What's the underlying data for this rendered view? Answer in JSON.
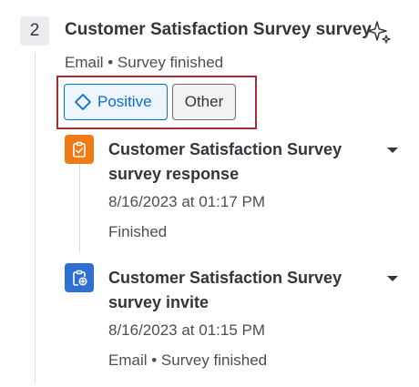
{
  "step": {
    "number": "2"
  },
  "survey": {
    "title": "Customer Satisfaction Survey survey",
    "subtitle": "Email • Survey finished"
  },
  "tags": {
    "positive_label": "Positive",
    "other_label": "Other"
  },
  "events": [
    {
      "title": "Customer Satisfaction Survey survey response",
      "date": "8/16/2023 at 01:17 PM",
      "status": "Finished",
      "icon": "clipboard-check-icon",
      "color": "#f07b16"
    },
    {
      "title": "Customer Satisfaction Survey survey invite",
      "date": "8/16/2023 at 01:15 PM",
      "status": "Email • Survey finished",
      "icon": "clipboard-add-icon",
      "color": "#2e6fcf"
    }
  ],
  "colors": {
    "highlight_border": "#a82b35",
    "positive_accent": "#0a6ed1",
    "text": "#32363a"
  }
}
